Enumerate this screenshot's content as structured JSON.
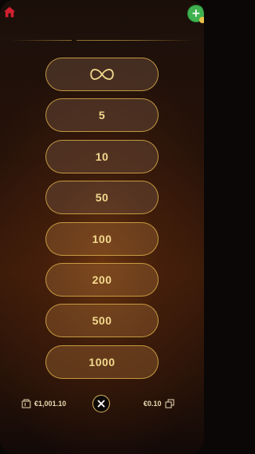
{
  "header": {
    "home_icon": "home-icon",
    "add_icon": "plus-icon",
    "add_label": "+",
    "colors": {
      "home": "#d3202e",
      "add": "#3fb24f",
      "add_badge": "#e9c14a"
    }
  },
  "autoplay": {
    "options": [
      {
        "label": "∞",
        "icon": "infinity-icon"
      },
      {
        "label": "5"
      },
      {
        "label": "10"
      },
      {
        "label": "50"
      },
      {
        "label": "100"
      },
      {
        "label": "200"
      },
      {
        "label": "500"
      },
      {
        "label": "1000"
      }
    ],
    "colors": {
      "border": "#d6aa48",
      "text": "#f3d98e"
    }
  },
  "footer": {
    "balance": "€1,001.10",
    "balance_icon": "wallet-icon",
    "close_icon": "close-icon",
    "bet": "€0.10",
    "bet_icon": "chips-icon"
  }
}
